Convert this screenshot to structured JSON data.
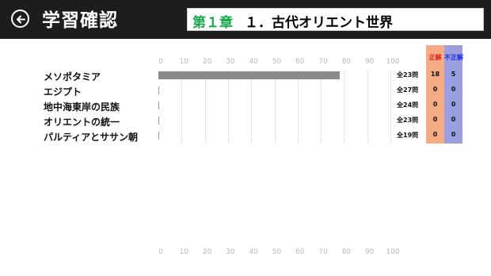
{
  "header": {
    "back_icon": "back-arrow-circle-icon",
    "title": "学習確認",
    "chapter_number": "第１章",
    "chapter_name": "１．古代オリエント世界"
  },
  "scale": {
    "ticks": [
      "0",
      "10",
      "20",
      "30",
      "40",
      "50",
      "60",
      "70",
      "80",
      "90",
      "100"
    ]
  },
  "columns": {
    "correct_label": "正解",
    "wrong_label": "不正解"
  },
  "rows": [
    {
      "label": "メソポタミア",
      "progress_percent": 78,
      "total": "全23問",
      "correct": "18",
      "wrong": "5"
    },
    {
      "label": "エジプト",
      "progress_percent": 0,
      "total": "全27問",
      "correct": "0",
      "wrong": "0"
    },
    {
      "label": "地中海東岸の民族",
      "progress_percent": 0,
      "total": "全24問",
      "correct": "0",
      "wrong": "0"
    },
    {
      "label": "オリエントの統一",
      "progress_percent": 0,
      "total": "全23問",
      "correct": "0",
      "wrong": "0"
    },
    {
      "label": "パルティアとササン朝",
      "progress_percent": 0,
      "total": "全19問",
      "correct": "0",
      "wrong": "0"
    }
  ],
  "colors": {
    "header_bg": "#1d1d1d",
    "chapter_accent": "#1aa64b",
    "progress_bar": "#8a8a8a",
    "correct_column": "#f5ab84",
    "wrong_column": "#9b9fe0",
    "correct_text": "#e0201b",
    "wrong_text": "#1b2be0"
  }
}
